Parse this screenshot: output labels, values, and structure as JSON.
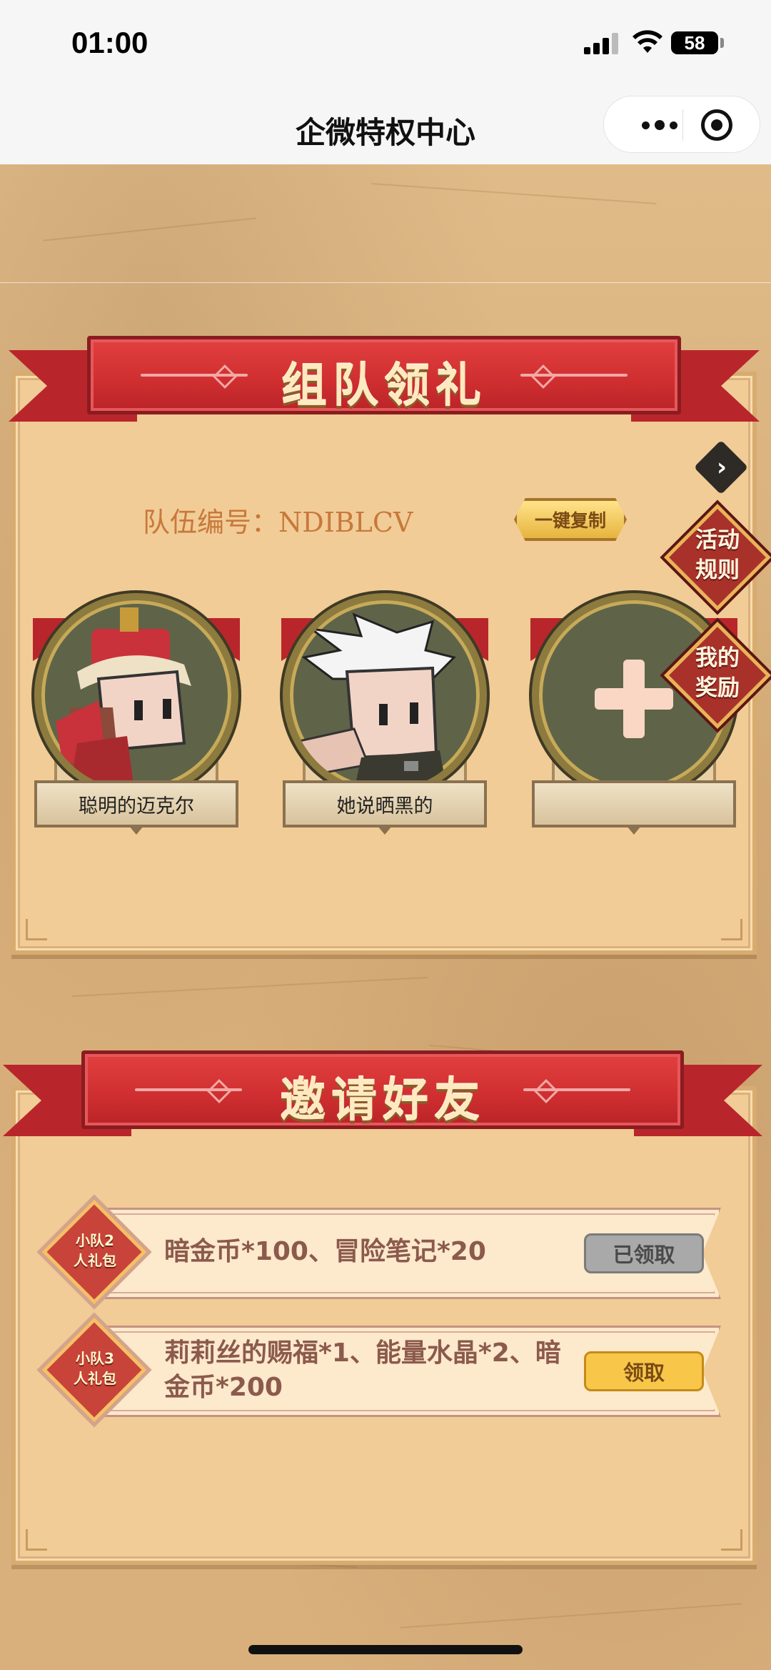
{
  "status_bar": {
    "time": "01:00",
    "battery": "58"
  },
  "nav": {
    "title": "企微特权中心"
  },
  "team": {
    "banner_title": "组队领礼",
    "team_label": "队伍编号：NDIBLCV",
    "copy_button": "一键复制",
    "members": [
      {
        "name": "聪明的迈克尔"
      },
      {
        "name": "她说晒黑的"
      },
      {
        "name": ""
      }
    ]
  },
  "side_buttons": {
    "rules": "活动规则",
    "rewards": "我的奖励"
  },
  "invite": {
    "banner_title": "邀请好友",
    "rewards": [
      {
        "badge": "小队2人礼包",
        "text": "暗金币*100、冒险笔记*20",
        "button": "已领取",
        "status": "claimed"
      },
      {
        "badge": "小队3人礼包",
        "text": "莉莉丝的赐福*1、能量水晶*2、暗金币*200",
        "button": "领取",
        "status": "available"
      }
    ]
  },
  "colors": {
    "ribbon_red": "#cf2e30",
    "panel": "#f1cc96",
    "claim_yellow": "#f8c74a",
    "claimed_gray": "#a9a9a9"
  }
}
